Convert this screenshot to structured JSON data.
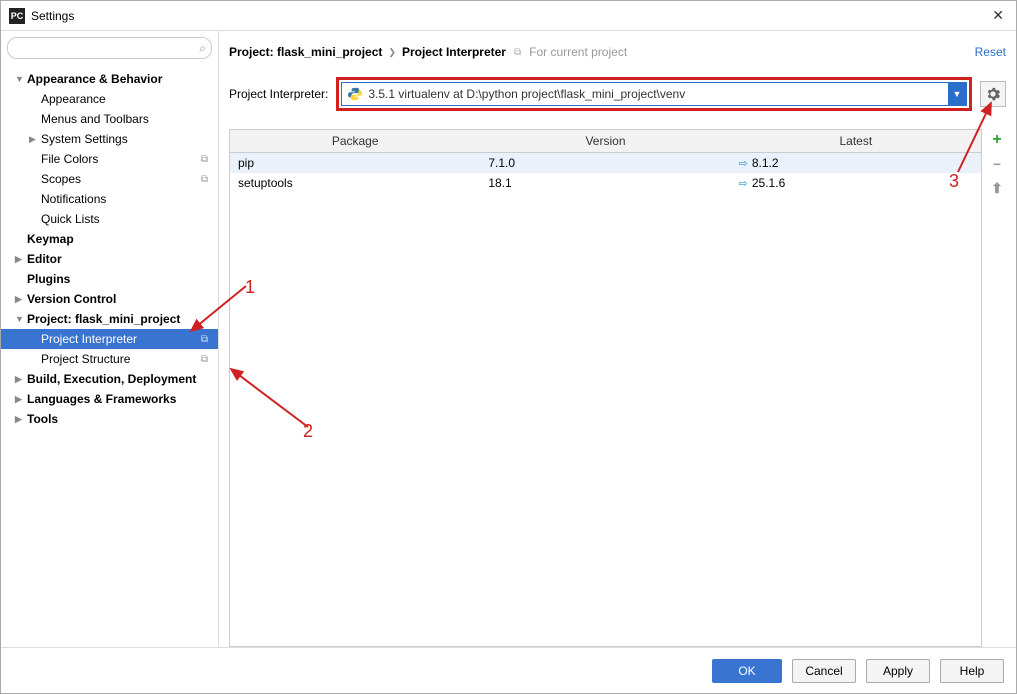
{
  "window": {
    "title": "Settings"
  },
  "search": {
    "placeholder": ""
  },
  "sidebar": {
    "items": [
      {
        "label": "Appearance & Behavior",
        "level": 1,
        "expandable": true,
        "expanded": true
      },
      {
        "label": "Appearance",
        "level": 2
      },
      {
        "label": "Menus and Toolbars",
        "level": 2
      },
      {
        "label": "System Settings",
        "level": 2,
        "expandable": true,
        "expanded": false
      },
      {
        "label": "File Colors",
        "level": 2,
        "copy": true
      },
      {
        "label": "Scopes",
        "level": 2,
        "copy": true
      },
      {
        "label": "Notifications",
        "level": 2
      },
      {
        "label": "Quick Lists",
        "level": 2
      },
      {
        "label": "Keymap",
        "level": 1
      },
      {
        "label": "Editor",
        "level": 1,
        "expandable": true,
        "expanded": false
      },
      {
        "label": "Plugins",
        "level": 1
      },
      {
        "label": "Version Control",
        "level": 1,
        "expandable": true,
        "expanded": false
      },
      {
        "label": "Project: flask_mini_project",
        "level": 1,
        "expandable": true,
        "expanded": true
      },
      {
        "label": "Project Interpreter",
        "level": 2,
        "copy": true,
        "selected": true
      },
      {
        "label": "Project Structure",
        "level": 2,
        "copy": true
      },
      {
        "label": "Build, Execution, Deployment",
        "level": 1,
        "expandable": true,
        "expanded": false
      },
      {
        "label": "Languages & Frameworks",
        "level": 1,
        "expandable": true,
        "expanded": false
      },
      {
        "label": "Tools",
        "level": 1,
        "expandable": true,
        "expanded": false
      }
    ]
  },
  "breadcrumb": {
    "part1": "Project: flask_mini_project",
    "part2": "Project Interpreter",
    "hint": "For current project",
    "reset": "Reset"
  },
  "interpreter": {
    "label": "Project Interpreter:",
    "value": "3.5.1 virtualenv at D:\\python project\\flask_mini_project\\venv"
  },
  "table": {
    "headers": {
      "package": "Package",
      "version": "Version",
      "latest": "Latest"
    },
    "rows": [
      {
        "package": "pip",
        "version": "7.1.0",
        "latest": "8.1.2",
        "upgrade": true
      },
      {
        "package": "setuptools",
        "version": "18.1",
        "latest": "25.1.6",
        "upgrade": true
      }
    ]
  },
  "footer": {
    "ok": "OK",
    "cancel": "Cancel",
    "apply": "Apply",
    "help": "Help"
  },
  "annotations": {
    "n1": "1",
    "n2": "2",
    "n3": "3"
  }
}
